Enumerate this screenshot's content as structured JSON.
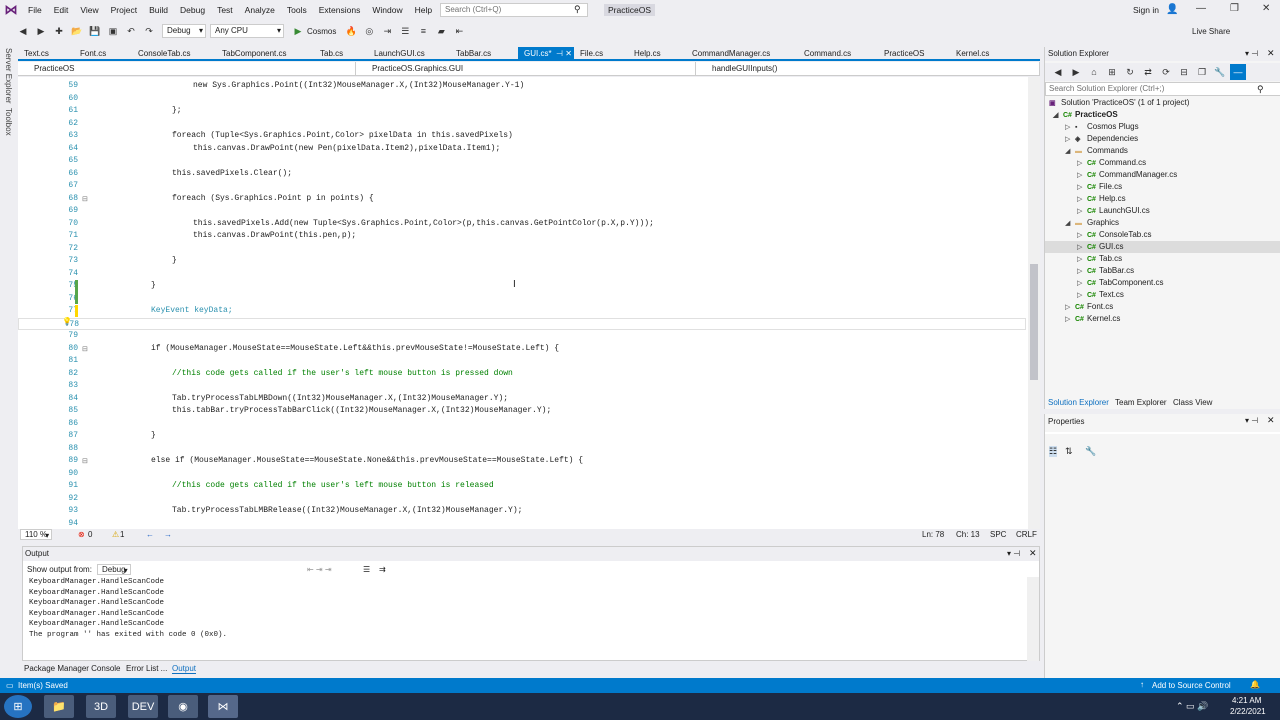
{
  "menu": {
    "items": [
      "File",
      "Edit",
      "View",
      "Project",
      "Build",
      "Debug",
      "Test",
      "Analyze",
      "Tools",
      "Extensions",
      "Window",
      "Help"
    ],
    "search_placeholder": "Search (Ctrl+Q)",
    "solution_name": "PracticeOS",
    "sign_in": "Sign in"
  },
  "toolbar": {
    "config": "Debug",
    "platform": "Any CPU",
    "run_target": "Cosmos",
    "live_share": "Live Share"
  },
  "sidebar": {
    "server_explorer": "Server Explorer",
    "toolbox": "Toolbox"
  },
  "editor_tabs": [
    {
      "label": "Text.cs"
    },
    {
      "label": "Font.cs"
    },
    {
      "label": "ConsoleTab.cs"
    },
    {
      "label": "TabComponent.cs"
    },
    {
      "label": "Tab.cs"
    },
    {
      "label": "LaunchGUI.cs"
    },
    {
      "label": "TabBar.cs"
    },
    {
      "label": "GUI.cs*",
      "active": true
    },
    {
      "label": "File.cs"
    },
    {
      "label": "Help.cs"
    },
    {
      "label": "CommandManager.cs"
    },
    {
      "label": "Command.cs"
    },
    {
      "label": "PracticeOS"
    },
    {
      "label": "Kernel.cs"
    }
  ],
  "navbar": {
    "project": "PracticeOS",
    "class": "PracticeOS.Graphics.GUI",
    "member": "handleGUIInputs()"
  },
  "code_lines": [
    {
      "n": "59",
      "t": "new Sys.Graphics.Point((Int32)MouseManager.X,(Int32)MouseManager.Y-1)"
    },
    {
      "n": "60",
      "t": ""
    },
    {
      "n": "61",
      "t": "};"
    },
    {
      "n": "62",
      "t": ""
    },
    {
      "n": "63",
      "t": "foreach (Tuple<Sys.Graphics.Point,Color> pixelData in this.savedPixels)"
    },
    {
      "n": "64",
      "t": "this.canvas.DrawPoint(new Pen(pixelData.Item2),pixelData.Item1);"
    },
    {
      "n": "65",
      "t": ""
    },
    {
      "n": "66",
      "t": "this.savedPixels.Clear();"
    },
    {
      "n": "67",
      "t": ""
    },
    {
      "n": "68",
      "t": "foreach (Sys.Graphics.Point p in points) {"
    },
    {
      "n": "69",
      "t": ""
    },
    {
      "n": "70",
      "t": "this.savedPixels.Add(new Tuple<Sys.Graphics.Point,Color>(p,this.canvas.GetPointColor(p.X,p.Y)));"
    },
    {
      "n": "71",
      "t": "this.canvas.DrawPoint(this.pen,p);"
    },
    {
      "n": "72",
      "t": ""
    },
    {
      "n": "73",
      "t": "}"
    },
    {
      "n": "74",
      "t": ""
    },
    {
      "n": "75",
      "t": "}"
    },
    {
      "n": "76",
      "t": ""
    },
    {
      "n": "77",
      "t": "KeyEvent keyData;"
    },
    {
      "n": "78",
      "t": ""
    },
    {
      "n": "79",
      "t": ""
    },
    {
      "n": "80",
      "t": "if (MouseManager.MouseState==MouseState.Left&&this.prevMouseState!=MouseState.Left) {"
    },
    {
      "n": "81",
      "t": ""
    },
    {
      "n": "82",
      "t": "//this code gets called if the user's left mouse button is pressed down"
    },
    {
      "n": "83",
      "t": ""
    },
    {
      "n": "84",
      "t": "Tab.tryProcessTabLMBDown((Int32)MouseManager.X,(Int32)MouseManager.Y);"
    },
    {
      "n": "85",
      "t": "this.tabBar.tryProcessTabBarClick((Int32)MouseManager.X,(Int32)MouseManager.Y);"
    },
    {
      "n": "86",
      "t": ""
    },
    {
      "n": "87",
      "t": "}"
    },
    {
      "n": "88",
      "t": ""
    },
    {
      "n": "89",
      "t": "else if (MouseManager.MouseState==MouseState.None&&this.prevMouseState==MouseState.Left) {"
    },
    {
      "n": "90",
      "t": ""
    },
    {
      "n": "91",
      "t": "//this code gets called if the user's left mouse button is released"
    },
    {
      "n": "92",
      "t": ""
    },
    {
      "n": "93",
      "t": "Tab.tryProcessTabLMBRelease((Int32)MouseManager.X,(Int32)MouseManager.Y);"
    },
    {
      "n": "94",
      "t": ""
    }
  ],
  "status": {
    "zoom": "110 %",
    "errors": "0",
    "warnings": "1",
    "ln": "Ln: 78",
    "ch": "Ch: 13",
    "spc": "SPC",
    "crlf": "CRLF"
  },
  "output": {
    "title": "Output",
    "show_from_label": "Show output from:",
    "source": "Debug",
    "lines": [
      "KeyboardManager.HandleScanCode",
      "KeyboardManager.HandleScanCode",
      "KeyboardManager.HandleScanCode",
      "KeyboardManager.HandleScanCode",
      "KeyboardManager.HandleScanCode",
      "The program '' has exited with code 0 (0x0)."
    ]
  },
  "bottom_tabs": [
    "Package Manager Console",
    "Error List ...",
    "Output"
  ],
  "app_status": {
    "message": "Item(s) Saved",
    "add_source": "Add to Source Control"
  },
  "solution_explorer": {
    "title": "Solution Explorer",
    "search_placeholder": "Search Solution Explorer (Ctrl+;)",
    "solution": "Solution 'PracticeOS' (1 of 1 project)",
    "tabs": [
      "Solution Explorer",
      "Team Explorer",
      "Class View"
    ],
    "tree": [
      {
        "label": "PracticeOS",
        "bold": true
      },
      {
        "label": "Cosmos Plugs"
      },
      {
        "label": "Dependencies"
      },
      {
        "label": "Commands"
      },
      {
        "label": "Command.cs"
      },
      {
        "label": "CommandManager.cs"
      },
      {
        "label": "File.cs"
      },
      {
        "label": "Help.cs"
      },
      {
        "label": "LaunchGUI.cs"
      },
      {
        "label": "Graphics"
      },
      {
        "label": "ConsoleTab.cs"
      },
      {
        "label": "GUI.cs",
        "selected": true
      },
      {
        "label": "Tab.cs"
      },
      {
        "label": "TabBar.cs"
      },
      {
        "label": "TabComponent.cs"
      },
      {
        "label": "Text.cs"
      },
      {
        "label": "Font.cs"
      },
      {
        "label": "Kernel.cs"
      }
    ]
  },
  "properties": {
    "title": "Properties"
  },
  "clock": {
    "time": "4:21 AM",
    "date": "2/22/2021"
  }
}
